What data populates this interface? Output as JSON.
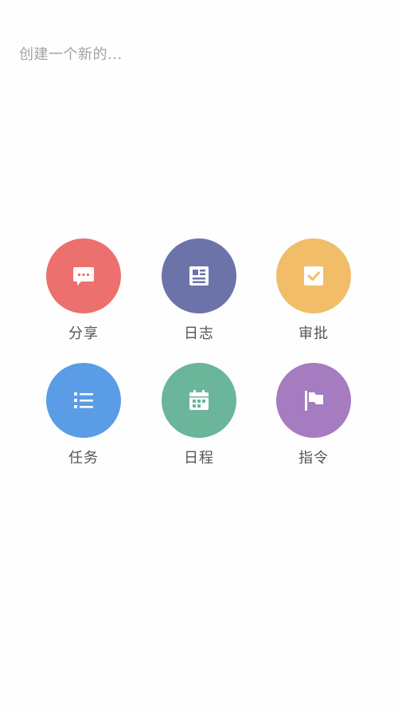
{
  "header": {
    "placeholder": "创建一个新的..."
  },
  "actions": [
    {
      "label": "分享",
      "icon": "chat-bubble-icon",
      "color": "#ec706e"
    },
    {
      "label": "日志",
      "icon": "news-document-icon",
      "color": "#6b73a8"
    },
    {
      "label": "审批",
      "icon": "checkbox-icon",
      "color": "#f2bd69"
    },
    {
      "label": "任务",
      "icon": "list-icon",
      "color": "#5b9ce6"
    },
    {
      "label": "日程",
      "icon": "calendar-icon",
      "color": "#6bb59b"
    },
    {
      "label": "指令",
      "icon": "flag-icon",
      "color": "#a57cc0"
    }
  ]
}
